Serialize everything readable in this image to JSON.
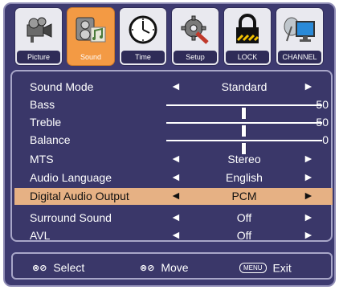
{
  "tabs": [
    {
      "label": "Picture",
      "icon": "camcorder-icon",
      "active": false
    },
    {
      "label": "Sound",
      "icon": "speaker-music-icon",
      "active": true
    },
    {
      "label": "Time",
      "icon": "clock-icon",
      "active": false
    },
    {
      "label": "Setup",
      "icon": "wrench-gear-icon",
      "active": false
    },
    {
      "label": "LOCK",
      "icon": "padlock-icon",
      "active": false
    },
    {
      "label": "CHANNEL",
      "icon": "satellite-monitor-icon",
      "active": false
    }
  ],
  "menu": {
    "items": [
      {
        "label": "Sound Mode",
        "type": "select",
        "value": "Standard"
      },
      {
        "label": "Bass",
        "type": "slider",
        "value": "50",
        "level": 0.5
      },
      {
        "label": "Treble",
        "type": "slider",
        "value": "50",
        "level": 0.5
      },
      {
        "label": "Balance",
        "type": "slider",
        "value": "0",
        "level": 0.5
      },
      {
        "label": "MTS",
        "type": "select",
        "value": "Stereo"
      },
      {
        "label": "Audio Language",
        "type": "select",
        "value": "English"
      },
      {
        "label": "Digital Audio Output",
        "type": "select",
        "value": "PCM",
        "selected": true
      },
      {
        "label": "Surround Sound",
        "type": "select",
        "value": "Off"
      },
      {
        "label": "AVL",
        "type": "select",
        "value": "Off"
      }
    ],
    "arrow_left": "◄",
    "arrow_right": "►"
  },
  "footer": {
    "select_glyph": "⊗⊘",
    "select_label": "Select",
    "move_glyph": "⊗⊘",
    "move_label": "Move",
    "menu_key": "MENU",
    "exit_label": "Exit"
  },
  "colors": {
    "background": "#3d3a70",
    "active_tab": "#f39a44",
    "highlight_row": "#e6b184",
    "text": "#ffffff"
  }
}
